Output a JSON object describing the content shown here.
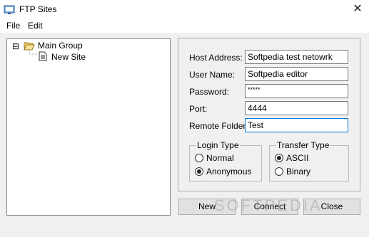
{
  "window": {
    "title": "FTP Sites",
    "close_glyph": "✕"
  },
  "menu": {
    "file": "File",
    "edit": "Edit"
  },
  "tree": {
    "group_toggle": "⊟",
    "group_label": "Main Group",
    "site_label": "New Site"
  },
  "form": {
    "host_label": "Host Address:",
    "host_value": "Softpedia test netowrk",
    "user_label": "User Name:",
    "user_value": "Softpedia editor",
    "password_label": "Password:",
    "password_value": "*****",
    "port_label": "Port:",
    "port_value": "4444",
    "remote_label": "Remote Folder:",
    "remote_value": "Test"
  },
  "login_type": {
    "legend": "Login Type",
    "options": [
      {
        "label": "Normal",
        "selected": false
      },
      {
        "label": "Anonymous",
        "selected": true
      }
    ]
  },
  "transfer_type": {
    "legend": "Transfer Type",
    "options": [
      {
        "label": "ASCII",
        "selected": true
      },
      {
        "label": "Binary",
        "selected": false
      }
    ]
  },
  "buttons": {
    "new": "New",
    "connect": "Connect",
    "close": "Close"
  },
  "watermark": "SOFTPEDIA",
  "colors": {
    "focus_border": "#0078d7",
    "folder_yellow": "#f5d26b"
  }
}
